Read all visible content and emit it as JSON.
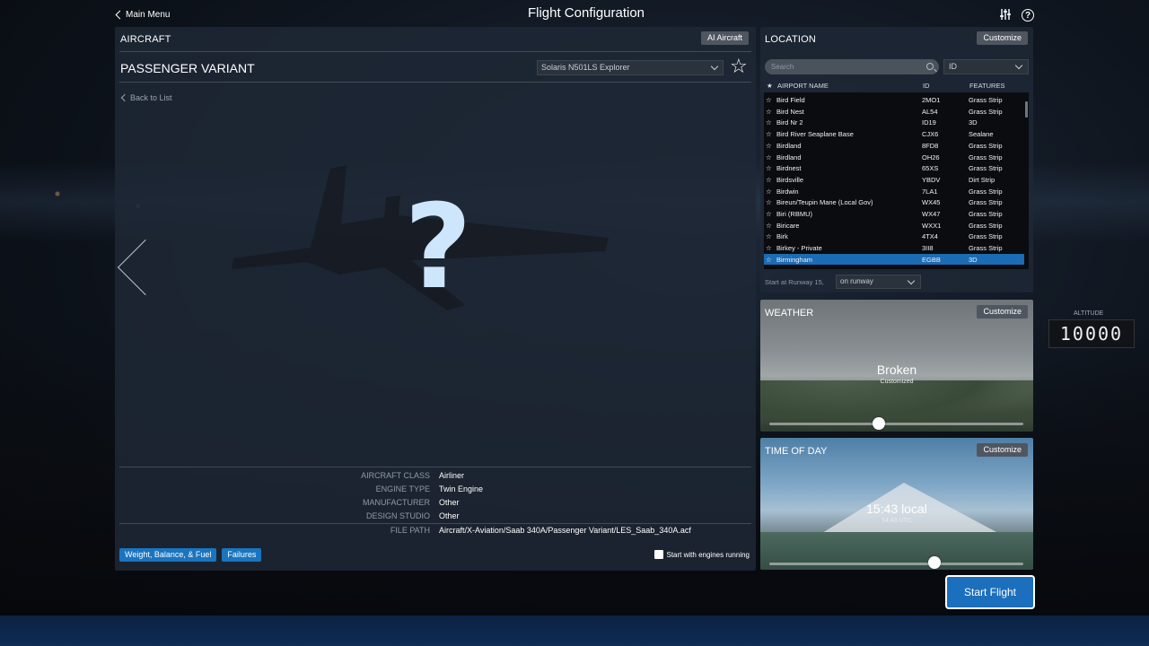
{
  "top_bar": {
    "main_menu": "Main Menu",
    "title": "Flight Configuration",
    "icons": [
      "sliders-icon",
      "help-icon"
    ]
  },
  "aircraft": {
    "section_title": "AIRCRAFT",
    "ai_button": "AI Aircraft",
    "variant_name": "PASSENGER VARIANT",
    "livery": "Solaris N501LS Explorer",
    "back_to_list": "Back to List",
    "placeholder_glyph": "?",
    "info": [
      {
        "label": "AIRCRAFT CLASS",
        "value": "Airliner"
      },
      {
        "label": "ENGINE TYPE",
        "value": "Twin Engine"
      },
      {
        "label": "MANUFACTURER",
        "value": "Other"
      },
      {
        "label": "DESIGN STUDIO",
        "value": "Other"
      },
      {
        "label": "FILE PATH",
        "value": "Aircraft/X-Aviation/Saab 340A/Passenger Variant/LES_Saab_340A.acf"
      }
    ],
    "weight_button": "Weight, Balance, & Fuel",
    "failures_button": "Failures",
    "engines_running_label": "Start with engines running",
    "engines_running_checked": false
  },
  "location": {
    "section_title": "LOCATION",
    "customize": "Customize",
    "search_placeholder": "Search",
    "sort_by": "ID",
    "columns": {
      "star": "★",
      "name": "AIRPORT NAME",
      "id": "ID",
      "features": "FEATURES"
    },
    "airports": [
      {
        "name": "Bird Field",
        "id": "2MO1",
        "features": "Grass Strip",
        "selected": false
      },
      {
        "name": "Bird Nest",
        "id": "AL54",
        "features": "Grass Strip",
        "selected": false
      },
      {
        "name": "Bird Nr 2",
        "id": "ID19",
        "features": "3D",
        "selected": false
      },
      {
        "name": "Bird River Seaplane Base",
        "id": "CJX6",
        "features": "Sealane",
        "selected": false
      },
      {
        "name": "Birdland",
        "id": "8FD8",
        "features": "Grass Strip",
        "selected": false
      },
      {
        "name": "Birdland",
        "id": "OH26",
        "features": "Grass Strip",
        "selected": false
      },
      {
        "name": "Birdnest",
        "id": "65XS",
        "features": "Grass Strip",
        "selected": false
      },
      {
        "name": "Birdsville",
        "id": "YBDV",
        "features": "Dirt Strip",
        "selected": false
      },
      {
        "name": "Birdwin",
        "id": "7LA1",
        "features": "Grass Strip",
        "selected": false
      },
      {
        "name": "Bireun/Teupin Mane (Local Gov)",
        "id": "WX45",
        "features": "Grass Strip",
        "selected": false
      },
      {
        "name": "Biri (RBMU)",
        "id": "WX47",
        "features": "Grass Strip",
        "selected": false
      },
      {
        "name": "Biricare",
        "id": "WXX1",
        "features": "Grass Strip",
        "selected": false
      },
      {
        "name": "Birk",
        "id": "4TX4",
        "features": "Grass Strip",
        "selected": false
      },
      {
        "name": "Birkey - Private",
        "id": "3II8",
        "features": "Grass Strip",
        "selected": false
      },
      {
        "name": "Birmingham",
        "id": "EGBB",
        "features": "3D",
        "selected": true
      }
    ],
    "start_label": "Start at Runway 15,",
    "start_mode": "on runway"
  },
  "weather": {
    "section_title": "WEATHER",
    "customize": "Customize",
    "condition": "Broken",
    "note": "Customized",
    "slider_fraction": 0.43
  },
  "time_of_day": {
    "section_title": "TIME OF DAY",
    "customize": "Customize",
    "local_time": "15:43 local",
    "utc_time": "14:43 UTC",
    "slider_fraction": 0.65
  },
  "start_flight": "Start Flight",
  "cockpit_altitude_readout": "10000",
  "cockpit_altitude_label": "ALTITUDE",
  "colors": {
    "accent_blue": "#1b6fbd",
    "selection_blue": "#1b6bb5",
    "panel_bg": "#1e2836"
  }
}
